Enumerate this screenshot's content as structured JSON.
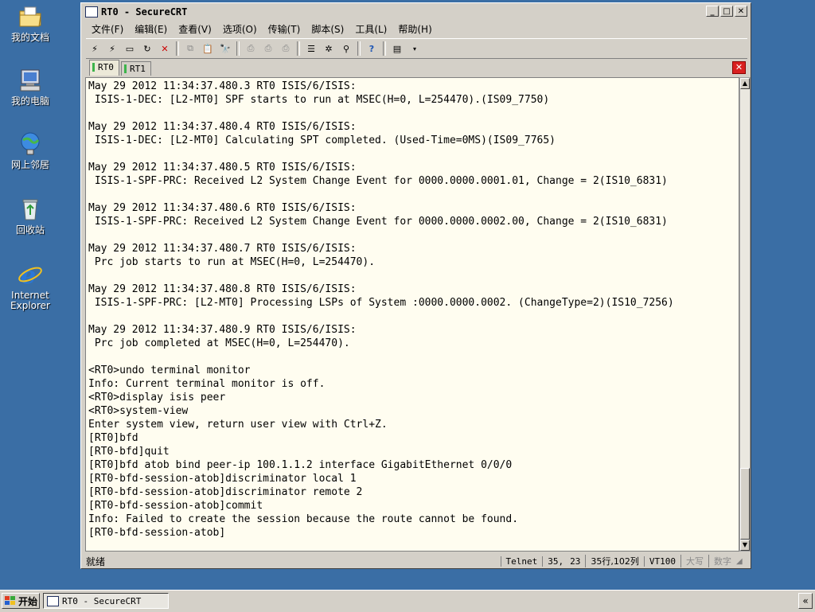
{
  "desktop": {
    "icons": [
      {
        "label": "我的文档",
        "icon": "folder-documents-icon"
      },
      {
        "label": "我的电脑",
        "icon": "computer-icon"
      },
      {
        "label": "网上邻居",
        "icon": "network-icon"
      },
      {
        "label": "回收站",
        "icon": "recycle-bin-icon"
      },
      {
        "label": "Internet Explorer",
        "icon": "internet-explorer-icon"
      }
    ]
  },
  "window": {
    "title": "RT0 - SecureCRT",
    "menu": [
      "文件(F)",
      "编辑(E)",
      "查看(V)",
      "选项(O)",
      "传输(T)",
      "脚本(S)",
      "工具(L)",
      "帮助(H)"
    ],
    "tabs": [
      {
        "label": "RT0",
        "active": true
      },
      {
        "label": "RT1",
        "active": false
      }
    ],
    "terminal_lines": [
      "May 29 2012 11:34:37.480.3 RT0 ISIS/6/ISIS:",
      " ISIS-1-DEC: [L2-MT0] SPF starts to run at MSEC(H=0, L=254470).(IS09_7750)",
      "",
      "May 29 2012 11:34:37.480.4 RT0 ISIS/6/ISIS:",
      " ISIS-1-DEC: [L2-MT0] Calculating SPT completed. (Used-Time=0MS)(IS09_7765)",
      "",
      "May 29 2012 11:34:37.480.5 RT0 ISIS/6/ISIS:",
      " ISIS-1-SPF-PRC: Received L2 System Change Event for 0000.0000.0001.01, Change = 2(IS10_6831)",
      "",
      "May 29 2012 11:34:37.480.6 RT0 ISIS/6/ISIS:",
      " ISIS-1-SPF-PRC: Received L2 System Change Event for 0000.0000.0002.00, Change = 2(IS10_6831)",
      "",
      "May 29 2012 11:34:37.480.7 RT0 ISIS/6/ISIS:",
      " Prc job starts to run at MSEC(H=0, L=254470).",
      "",
      "May 29 2012 11:34:37.480.8 RT0 ISIS/6/ISIS:",
      " ISIS-1-SPF-PRC: [L2-MT0] Processing LSPs of System :0000.0000.0002. (ChangeType=2)(IS10_7256)",
      "",
      "May 29 2012 11:34:37.480.9 RT0 ISIS/6/ISIS:",
      " Prc job completed at MSEC(H=0, L=254470).",
      "",
      "<RT0>undo terminal monitor",
      "Info: Current terminal monitor is off.",
      "<RT0>display isis peer",
      "<RT0>system-view",
      "Enter system view, return user view with Ctrl+Z.",
      "[RT0]bfd",
      "[RT0-bfd]quit",
      "[RT0]bfd atob bind peer-ip 100.1.1.2 interface GigabitEthernet 0/0/0",
      "[RT0-bfd-session-atob]discriminator local 1",
      "[RT0-bfd-session-atob]discriminator remote 2",
      "[RT0-bfd-session-atob]commit",
      "Info: Failed to create the session because the route cannot be found.",
      "[RT0-bfd-session-atob]"
    ],
    "status": {
      "ready": "就绪",
      "protocol": "Telnet",
      "row": "35,",
      "col": "23",
      "size": "35行,102列",
      "emulation": "VT100",
      "caps": "大写",
      "num": "数字"
    }
  },
  "taskbar": {
    "start_label": "开始",
    "task_label": "RT0 - SecureCRT",
    "tray_label": "«"
  },
  "colors": {
    "desktop": "#3a6ea5",
    "terminal_bg": "#fffdf0",
    "chrome": "#d4d0c8"
  }
}
